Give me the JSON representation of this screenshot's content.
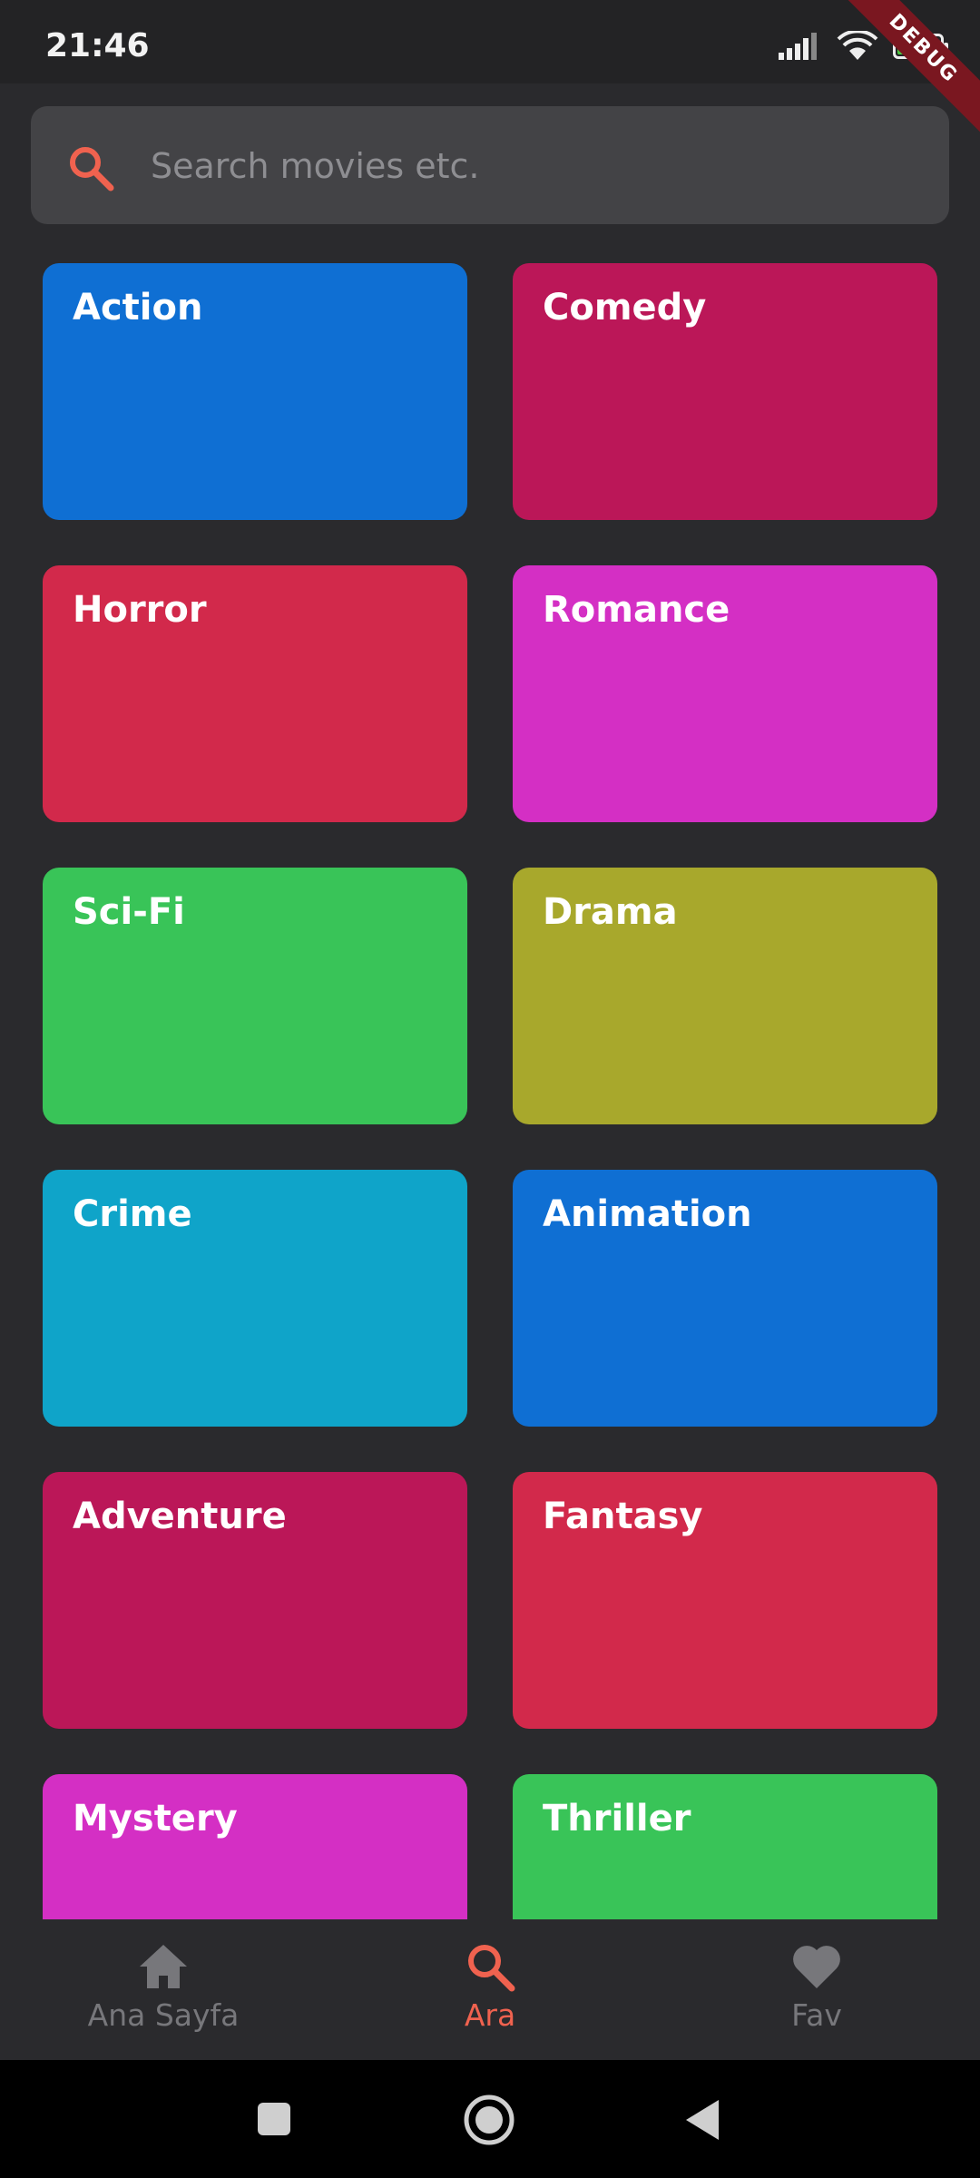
{
  "status_bar": {
    "time": "21:46",
    "battery": "58",
    "battery_level": 0.58,
    "debug_banner": "DEBUG"
  },
  "search": {
    "placeholder": "Search movies etc.",
    "icon": "search-icon",
    "icon_color": "#f0624f"
  },
  "genres": [
    {
      "label": "Action",
      "color": "#0f6fd3"
    },
    {
      "label": "Comedy",
      "color": "#bb1758"
    },
    {
      "label": "Horror",
      "color": "#d2294b"
    },
    {
      "label": "Romance",
      "color": "#d42fc4"
    },
    {
      "label": "Sci-Fi",
      "color": "#39c458"
    },
    {
      "label": "Drama",
      "color": "#a8a82c"
    },
    {
      "label": "Crime",
      "color": "#0fa4c9"
    },
    {
      "label": "Animation",
      "color": "#0f6fd3"
    },
    {
      "label": "Adventure",
      "color": "#bb1758"
    },
    {
      "label": "Fantasy",
      "color": "#d2294b"
    },
    {
      "label": "Mystery",
      "color": "#d42fc4"
    },
    {
      "label": "Thriller",
      "color": "#39c458"
    }
  ],
  "bottom_nav": {
    "items": [
      {
        "label": "Ana Sayfa",
        "icon": "home-icon",
        "active": false
      },
      {
        "label": "Ara",
        "icon": "search-icon",
        "active": true
      },
      {
        "label": "Fav",
        "icon": "heart-icon",
        "active": false
      }
    ],
    "active_color": "#f0624f",
    "inactive_color": "#77777b"
  }
}
